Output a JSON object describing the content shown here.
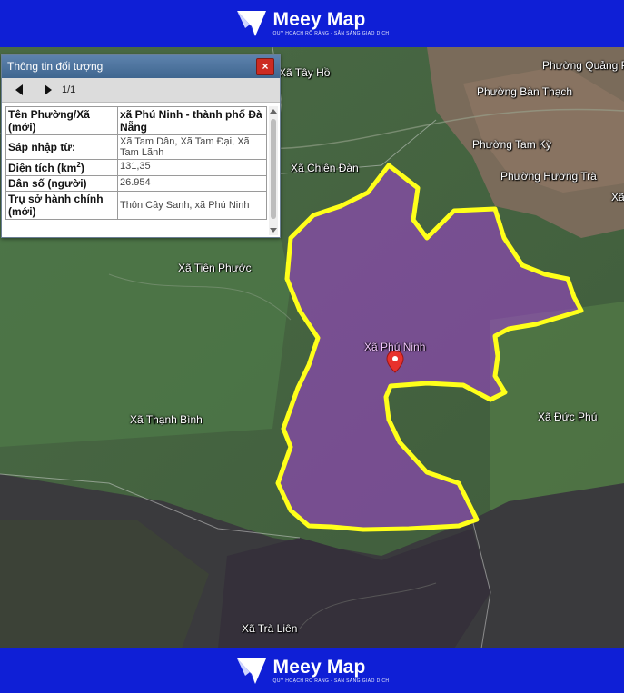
{
  "brand": {
    "name": "Meey Map",
    "tagline": "QUY HOẠCH RÕ RÀNG - SẴN SÀNG GIAO DỊCH"
  },
  "panel": {
    "title": "Thông tin đối tượng",
    "close": "×",
    "page": "1/1",
    "rows": [
      {
        "key": "Tên Phường/Xã (mới)",
        "value": "xã Phú Ninh - thành phố Đà Nẵng"
      },
      {
        "key": "Sáp nhập từ:",
        "value": "Xã Tam Dân, Xã Tam Đại, Xã Tam Lãnh"
      },
      {
        "key_main": "Diện tích (km",
        "key_sup": "2",
        "key_end": ")",
        "value": "131,35"
      },
      {
        "key": "Dân số (người)",
        "value": "26.954"
      },
      {
        "key": "Trụ sở hành chính (mới)",
        "value": "Thôn Cây Sanh, xã Phú Ninh"
      }
    ]
  },
  "map": {
    "selected_label": "Xã Phú Ninh",
    "boundary_color": "#ffff1a",
    "fill_color": "#a23fd3",
    "places": {
      "tay_ho": "Xã Tây Hồ",
      "quang_phu": "Phường Quảng Phú",
      "ban_thach": "Phường Bàn Thạch",
      "tam_ky": "Phường Tam Kỳ",
      "huong_tra": "Phường Hương Trà",
      "chien_dan": "Xã Chiên Đàn",
      "tien_phuoc": "Xã Tiên Phước",
      "thanh_binh": "Xã Thạnh Bình",
      "duc_phu": "Xã Đức Phú",
      "tra_lien": "Xã Trà Liên",
      "edge_xa": "Xã"
    }
  }
}
